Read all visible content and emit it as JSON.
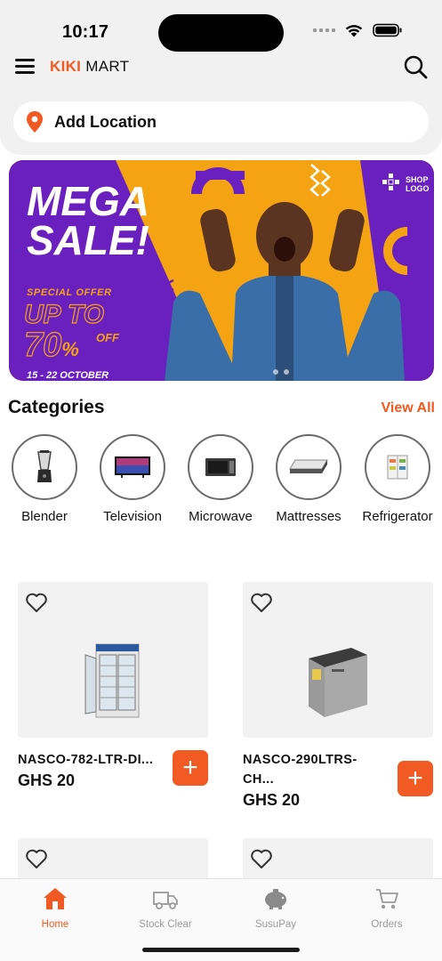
{
  "status": {
    "time": "10:17"
  },
  "brand": {
    "accent": "KIKI",
    "rest": "MART"
  },
  "location": {
    "label": "Add Location"
  },
  "banner": {
    "headline1": "MEGA",
    "headline2": "SALE!",
    "special": "SPECIAL OFFER",
    "upto": "UP TO",
    "percent": "70",
    "percent_sign": "%",
    "off": "OFF",
    "dates": "15 - 22 OCTOBER",
    "shop_logo_1": "SHOP",
    "shop_logo_2": "LOGO"
  },
  "categories": {
    "title": "Categories",
    "view_all": "View All",
    "items": [
      {
        "name": "Blender",
        "icon": "blender-icon"
      },
      {
        "name": "Television",
        "icon": "television-icon"
      },
      {
        "name": "Microwave",
        "icon": "microwave-icon"
      },
      {
        "name": "Mattresses",
        "icon": "mattress-icon"
      },
      {
        "name": "Refrigerator",
        "icon": "refrigerator-icon"
      }
    ]
  },
  "products": [
    {
      "name": "NASCO-782-LTR-DI...",
      "price": "GHS 20"
    },
    {
      "name": "NASCO-290LTRS-CH...",
      "price": "GHS 20"
    }
  ],
  "add_symbol": "+",
  "tabs": [
    {
      "label": "Home",
      "icon": "home-icon",
      "active": true
    },
    {
      "label": "Stock Clear",
      "icon": "truck-icon",
      "active": false
    },
    {
      "label": "SusuPay",
      "icon": "piggy-bank-icon",
      "active": false
    },
    {
      "label": "Orders",
      "icon": "cart-icon",
      "active": false
    }
  ],
  "colors": {
    "accent": "#f15a22",
    "banner_purple": "#6a1fbf",
    "banner_yellow": "#f4a413"
  }
}
